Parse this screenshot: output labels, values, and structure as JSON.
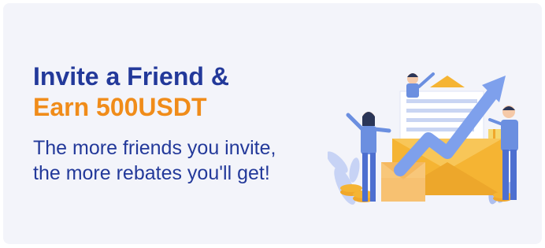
{
  "banner": {
    "title_line1": "Invite a Friend &",
    "title_line2": "Earn 500USDT",
    "subtitle_line1": "The more friends you invite,",
    "subtitle_line2": "the more rebates you'll get!"
  },
  "colors": {
    "background": "#f3f4fa",
    "title_blue": "#23399a",
    "accent_orange": "#f08c1a",
    "illustration_blue": "#6b8fe0",
    "envelope_yellow": "#f5b433"
  },
  "illustration": {
    "name": "referral-illustration",
    "elements": [
      "person-waving",
      "person-on-arrow",
      "person-holding-gift",
      "envelopes",
      "rising-arrow",
      "coins",
      "leaves"
    ]
  }
}
